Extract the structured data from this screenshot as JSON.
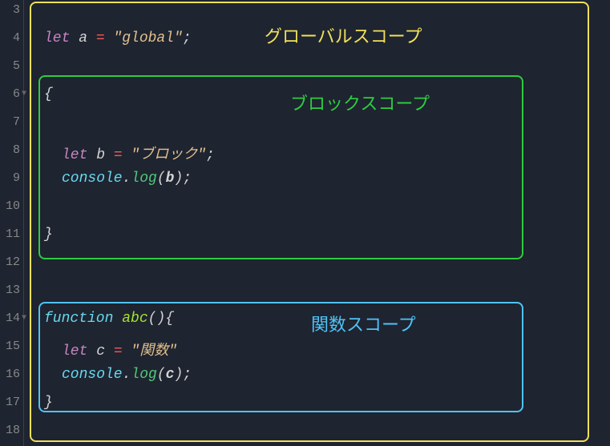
{
  "gutter": {
    "lines": [
      "3",
      "4",
      "5",
      "6",
      "7",
      "8",
      "9",
      "10",
      "11",
      "12",
      "13",
      "14",
      "15",
      "16",
      "17",
      "18"
    ]
  },
  "code": {
    "l4_let": "let",
    "l4_var": " a ",
    "l4_eq": "=",
    "l4_str": " \"global\"",
    "l4_semi": ";",
    "l6_brace": "{",
    "l8_let": "let",
    "l8_var": " b ",
    "l8_eq": "=",
    "l8_str": " \"ブロック\"",
    "l8_semi": ";",
    "l9_obj": "console",
    "l9_dot": ".",
    "l9_method": "log",
    "l9_open": "(",
    "l9_param": "b",
    "l9_close": ")",
    "l9_semi": ";",
    "l11_brace": "}",
    "l14_fn": "function",
    "l14_name": " abc",
    "l14_open": "(",
    "l14_close": ")",
    "l14_brace": "{",
    "l15_let": "let",
    "l15_var": " c ",
    "l15_eq": "=",
    "l15_str": " \"関数\"",
    "l16_obj": "console",
    "l16_dot": ".",
    "l16_method": "log",
    "l16_open": "(",
    "l16_param": "c",
    "l16_close": ")",
    "l16_semi": ";",
    "l17_brace": "}"
  },
  "labels": {
    "global": "グローバルスコープ",
    "block": "ブロックスコープ",
    "function": "関数スコープ"
  }
}
